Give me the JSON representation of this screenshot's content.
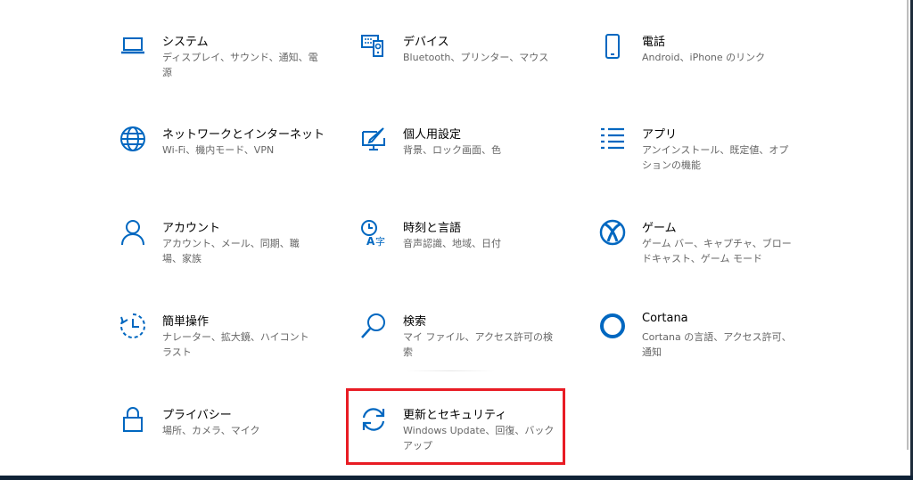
{
  "accent_color": "#0067c0",
  "highlight_color": "#e81c24",
  "tiles": [
    {
      "title": "システム",
      "desc": "ディスプレイ、サウンド、通知、電源",
      "icon": "laptop-icon"
    },
    {
      "title": "デバイス",
      "desc": "Bluetooth、プリンター、マウス",
      "icon": "devices-icon"
    },
    {
      "title": "電話",
      "desc": "Android、iPhone のリンク",
      "icon": "phone-icon"
    },
    {
      "title": "ネットワークとインターネット",
      "desc": "Wi-Fi、機内モード、VPN",
      "icon": "globe-icon"
    },
    {
      "title": "個人用設定",
      "desc": "背景、ロック画面、色",
      "icon": "personalization-icon"
    },
    {
      "title": "アプリ",
      "desc": "アンインストール、既定値、オプションの機能",
      "icon": "apps-list-icon"
    },
    {
      "title": "アカウント",
      "desc": "アカウント、メール、同期、職場、家族",
      "icon": "person-icon"
    },
    {
      "title": "時刻と言語",
      "desc": "音声認識、地域、日付",
      "icon": "time-language-icon"
    },
    {
      "title": "ゲーム",
      "desc": "ゲーム バー、キャプチャ、ブロードキャスト、ゲーム モード",
      "icon": "xbox-icon"
    },
    {
      "title": "簡単操作",
      "desc": "ナレーター、拡大鏡、ハイコントラスト",
      "icon": "ease-of-access-icon"
    },
    {
      "title": "検索",
      "desc": "マイ ファイル、アクセス許可の検索",
      "icon": "search-icon"
    },
    {
      "title": "Cortana",
      "desc": "Cortana の言語、アクセス許可、通知",
      "icon": "cortana-icon"
    },
    {
      "title": "プライバシー",
      "desc": "場所、カメラ、マイク",
      "icon": "lock-icon"
    },
    {
      "title": "更新とセキュリティ",
      "desc": "Windows Update、回復、バックアップ",
      "icon": "sync-icon"
    }
  ]
}
